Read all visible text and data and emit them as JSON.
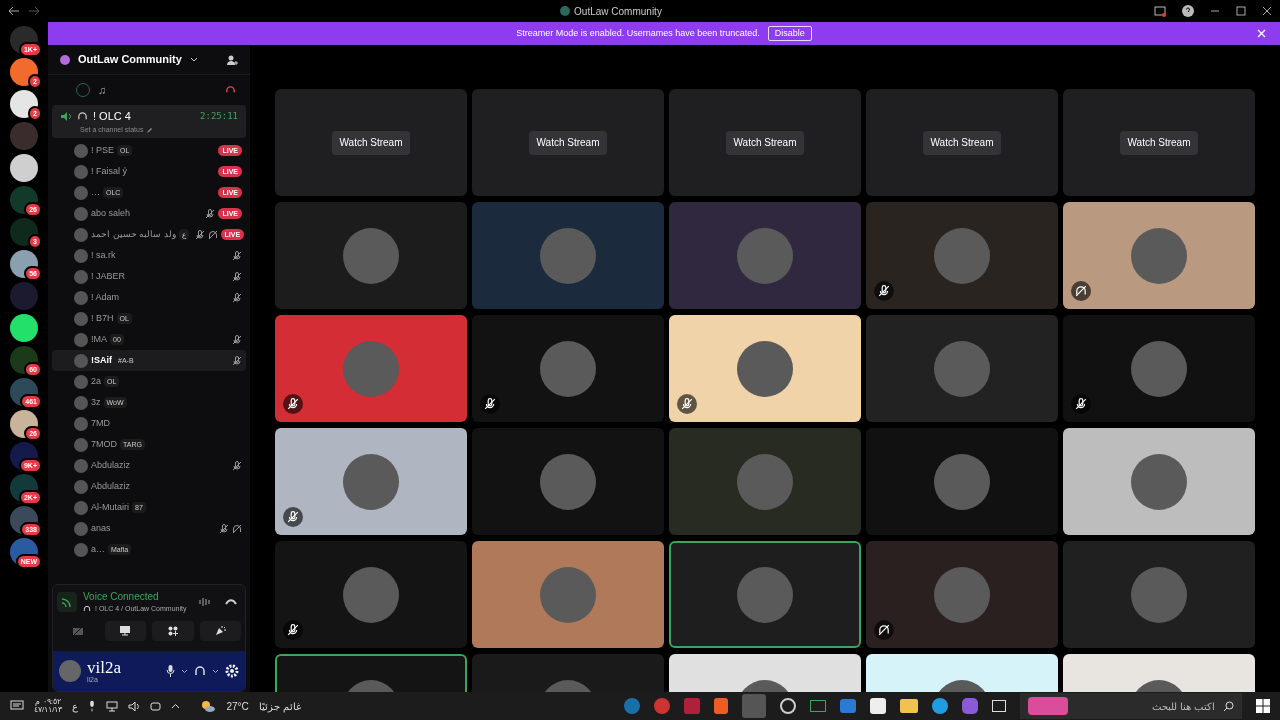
{
  "window": {
    "title": "OutLaw Community"
  },
  "banner": {
    "text": "Streamer Mode is enabled. Usernames have been truncated.",
    "button": "Disable"
  },
  "servers": [
    {
      "badge": "1K+",
      "color": "#2a2a2a"
    },
    {
      "badge": "2",
      "color": "#f26b2c"
    },
    {
      "badge": "2",
      "color": "#e5e5e5"
    },
    {
      "color": "#3a2c2c"
    },
    {
      "color": "#cfcfcf"
    },
    {
      "badge": "26",
      "color": "#123a2a"
    },
    {
      "badge": "3",
      "color": "#0f2a1c"
    },
    {
      "badge": "56",
      "color": "#8aa0b0"
    },
    {
      "color": "#1c1a2e"
    },
    {
      "color": "#22e06a"
    },
    {
      "badge": "60",
      "color": "#1a3a1a"
    },
    {
      "badge": "461",
      "color": "#2c4a5a"
    },
    {
      "badge": "26",
      "color": "#c8b49a"
    },
    {
      "badge": "9K+",
      "color": "#141a4a"
    },
    {
      "badge": "2K+",
      "color": "#123a3a"
    },
    {
      "badge": "338",
      "color": "#3a4a5a"
    },
    {
      "badge": "NEW",
      "color": "#2a5aa0"
    }
  ],
  "channel_panel": {
    "server_name": "OutLaw Community",
    "music_channel": "♫",
    "voice_channel": {
      "name": "! OLC 4",
      "timer": "2:25:11",
      "status_placeholder": "Set a channel status"
    },
    "members": [
      {
        "name": "! PSE",
        "tag": "OL",
        "live": "LIVE",
        "muted": false,
        "deafened": false,
        "selected": false
      },
      {
        "name": "! Faisal ỷ",
        "live": "LIVE",
        "muted": false,
        "deafened": false,
        "selected": false
      },
      {
        "name": "…",
        "tag": "OLC",
        "live": "LIVE",
        "muted": false,
        "deafened": false,
        "selected": false
      },
      {
        "name": "abo saleh",
        "live": "LIVE",
        "muted": true,
        "deafened": false,
        "selected": false
      },
      {
        "name": "ولد سالبه حسين احمد",
        "tag": "ع",
        "live": "LIVE",
        "muted": true,
        "deafened": true,
        "selected": false
      },
      {
        "name": "! sa.rk",
        "muted": true,
        "deafened": false,
        "selected": false
      },
      {
        "name": "! JABER",
        "muted": true,
        "deafened": false,
        "selected": false
      },
      {
        "name": "! Adam",
        "muted": true,
        "deafened": false,
        "selected": false
      },
      {
        "name": "! B7H",
        "tag": "OL",
        "muted": false,
        "deafened": false,
        "selected": false
      },
      {
        "name": "!MA",
        "tag": "00",
        "muted": true,
        "deafened": false,
        "selected": false
      },
      {
        "name": "!SAif",
        "tag": "#A-B",
        "muted": true,
        "deafened": false,
        "selected": true
      },
      {
        "name": "2a",
        "tag": "OL",
        "muted": false,
        "deafened": false,
        "selected": false
      },
      {
        "name": "3z",
        "tag": "WoW",
        "muted": false,
        "deafened": false,
        "selected": false
      },
      {
        "name": "7MD",
        "muted": false,
        "deafened": false,
        "selected": false
      },
      {
        "name": "7MOD",
        "tag": "TARG",
        "muted": false,
        "deafened": false,
        "selected": false
      },
      {
        "name": "Abdulaziz",
        "muted": true,
        "deafened": false,
        "selected": false
      },
      {
        "name": "Abdulaziz",
        "muted": false,
        "deafened": false,
        "selected": false
      },
      {
        "name": "Al-Mutairi",
        "tag": "87",
        "muted": false,
        "deafened": false,
        "selected": false
      },
      {
        "name": "anas",
        "muted": true,
        "deafened": true,
        "selected": false
      },
      {
        "name": "a…",
        "tag": "Mafia",
        "muted": false,
        "deafened": false,
        "selected": false
      }
    ]
  },
  "voice_panel": {
    "title": "Voice Connected",
    "location": "! OLC 4 / OutLaw Community",
    "user": "vil2a",
    "user_sub": "li2a"
  },
  "tiles": [
    {
      "kind": "stream",
      "label": "Watch Stream"
    },
    {
      "kind": "stream",
      "label": "Watch Stream"
    },
    {
      "kind": "stream",
      "label": "Watch Stream"
    },
    {
      "kind": "stream",
      "label": "Watch Stream"
    },
    {
      "kind": "stream",
      "label": "Watch Stream"
    },
    {
      "kind": "user",
      "color": "#1c1c1c",
      "muted": false,
      "deafened": false,
      "speaking": false
    },
    {
      "kind": "user",
      "color": "#1b2b3d",
      "muted": false,
      "deafened": false,
      "speaking": false
    },
    {
      "kind": "user",
      "color": "#30283f",
      "muted": false,
      "deafened": false,
      "speaking": false
    },
    {
      "kind": "user",
      "color": "#2a2420",
      "muted": true,
      "deafened": false,
      "speaking": false
    },
    {
      "kind": "user",
      "color": "#b99a80",
      "muted": false,
      "deafened": true,
      "speaking": false
    },
    {
      "kind": "user",
      "color": "#d42d35",
      "muted": true,
      "deafened": false,
      "speaking": false
    },
    {
      "kind": "user",
      "color": "#121212",
      "muted": true,
      "deafened": false,
      "speaking": false
    },
    {
      "kind": "user",
      "color": "#f0d3a8",
      "muted": true,
      "deafened": false,
      "speaking": false
    },
    {
      "kind": "user",
      "color": "#222222",
      "muted": false,
      "deafened": false,
      "speaking": false
    },
    {
      "kind": "user",
      "color": "#111111",
      "muted": true,
      "deafened": false,
      "speaking": false
    },
    {
      "kind": "user",
      "color": "#b0b5c2",
      "muted": true,
      "deafened": false,
      "speaking": false
    },
    {
      "kind": "user",
      "color": "#121212",
      "muted": false,
      "deafened": false,
      "speaking": false
    },
    {
      "kind": "user",
      "color": "#272b22",
      "muted": false,
      "deafened": false,
      "speaking": false
    },
    {
      "kind": "user",
      "color": "#111111",
      "muted": false,
      "deafened": false,
      "speaking": false
    },
    {
      "kind": "user",
      "color": "#bdbdbd",
      "muted": false,
      "deafened": false,
      "speaking": false
    },
    {
      "kind": "user",
      "color": "#141414",
      "muted": true,
      "deafened": false,
      "speaking": false
    },
    {
      "kind": "user",
      "color": "#b07a5a",
      "muted": false,
      "deafened": false,
      "speaking": false
    },
    {
      "kind": "user",
      "color": "#1e1e1e",
      "muted": false,
      "deafened": false,
      "speaking": true
    },
    {
      "kind": "user",
      "color": "#2a2020",
      "muted": false,
      "deafened": true,
      "speaking": false
    },
    {
      "kind": "user",
      "color": "#202020",
      "muted": false,
      "deafened": false,
      "speaking": false
    },
    {
      "kind": "user",
      "color": "#141414",
      "speaking": true
    },
    {
      "kind": "user",
      "color": "#1a1a1a",
      "speaking": false
    },
    {
      "kind": "user",
      "color": "#e0e0e0",
      "speaking": false
    },
    {
      "kind": "user",
      "color": "#d5f3f8",
      "speaking": false
    },
    {
      "kind": "user",
      "color": "#e8e4e0",
      "speaking": false
    }
  ],
  "taskbar": {
    "time": "٠٩:٥٢ م",
    "date": "٤٧/١١/١٣",
    "language": "ع",
    "temperature": "27°C",
    "weather": "غائم جزئيًا",
    "search_placeholder": "اكتب هنا للبحث"
  }
}
